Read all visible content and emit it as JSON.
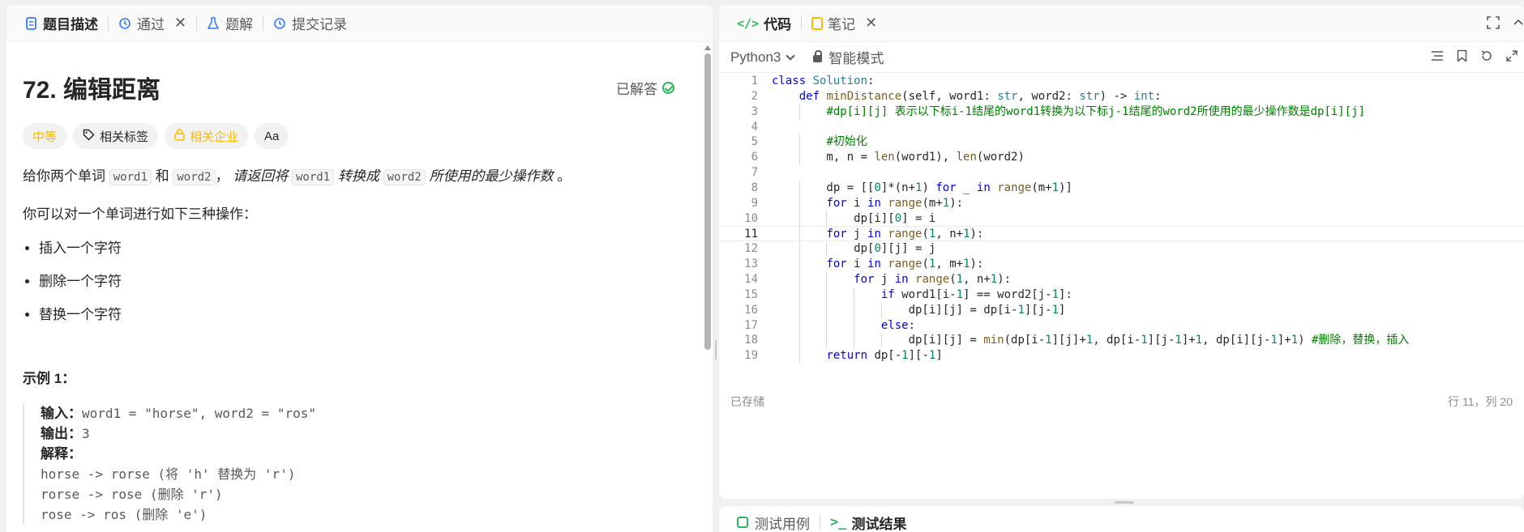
{
  "left_tabs": [
    {
      "label": "题目描述",
      "icon": "document-icon",
      "active": true
    },
    {
      "label": "通过",
      "icon": "history-icon",
      "active": false,
      "closable": true
    },
    {
      "label": "题解",
      "icon": "flask-icon",
      "active": false
    },
    {
      "label": "提交记录",
      "icon": "history-icon",
      "active": false
    }
  ],
  "problem": {
    "title": "72. 编辑距离",
    "status": "已解答",
    "tags": {
      "difficulty": "中等",
      "related_tags": "相关标签",
      "related_companies": "相关企业",
      "translate_icon": "Aa"
    },
    "desc": {
      "t1": "给你两个单词 ",
      "c1": "word1",
      "t2": " 和 ",
      "c2": "word2",
      "t3": "， ",
      "e1": "请返回将 ",
      "c3": "word1",
      "e2": " 转换成 ",
      "c4": "word2",
      "e3": " 所使用的最少操作数",
      "t4": " 。"
    },
    "intro": "你可以对一个单词进行如下三种操作：",
    "ops": [
      "插入一个字符",
      "删除一个字符",
      "替换一个字符"
    ],
    "example": {
      "title": "示例 1：",
      "input_label": "输入：",
      "input_value": "word1 = \"horse\", word2 = \"ros\"",
      "output_label": "输出：",
      "output_value": "3",
      "explain_label": "解释：",
      "lines": [
        "horse -> rorse (将 'h' 替换为 'r')",
        "rorse -> rose (删除 'r')",
        "rose -> ros (删除 'e')"
      ]
    }
  },
  "right_tabs": [
    {
      "label": "代码",
      "icon": "code-icon",
      "active": true
    },
    {
      "label": "笔记",
      "icon": "note-icon",
      "active": false,
      "closable": true
    }
  ],
  "editor": {
    "language": "Python3",
    "mode": "智能模式",
    "saved": "已存储",
    "cursor": "行 11，列 20",
    "current_line": 11
  },
  "bottom_tabs": [
    {
      "label": "测试用例",
      "icon": "checkbox-icon",
      "active": false
    },
    {
      "label": "测试结果",
      "icon": "terminal-icon",
      "active": true
    }
  ],
  "colors": {
    "accent_green": "#2db55d",
    "medium_orange": "#ffb800",
    "keyword_blue": "#0000ff",
    "comment_green": "#008000"
  }
}
